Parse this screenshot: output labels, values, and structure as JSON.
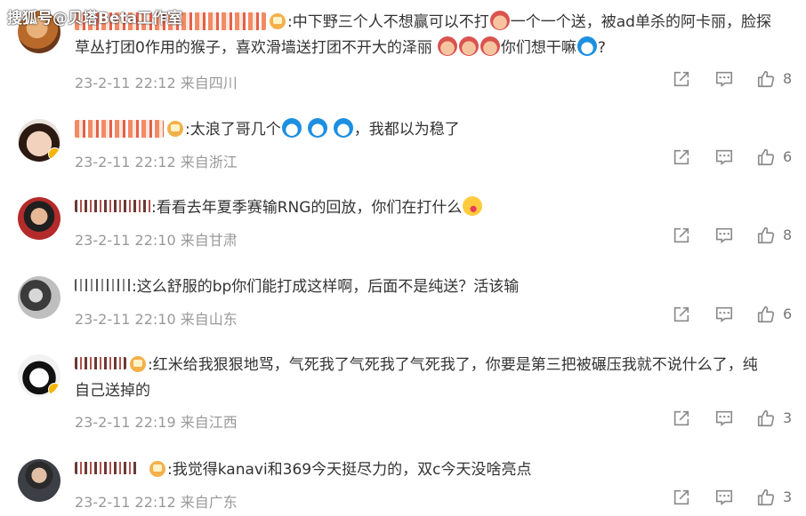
{
  "watermark": "搜狐号@贝塔Beta工作室",
  "comments": [
    {
      "text_parts": [
        ":中下野三个人不想赢可以不打",
        "一个一个送，被ad单杀的阿卡丽，脸探",
        "草丛打团0作用的猴子，喜欢滑墙送打团不开大的泽丽",
        "你们想干嘛",
        "?"
      ],
      "meta": "23-2-11 22:12 来自四川",
      "likes": "8"
    },
    {
      "text_parts": [
        ":太浪了哥几个",
        "，我都以为稳了"
      ],
      "meta": "23-2-11 22:12 来自浙江",
      "likes": "6"
    },
    {
      "text_parts": [
        ":看看去年夏季赛输RNG的回放，你们在打什么"
      ],
      "meta": "23-2-11 22:10 来自甘肃",
      "likes": "8"
    },
    {
      "text_parts": [
        ":这么舒服的bp你们能打成这样啊，后面不是纯送？活该输"
      ],
      "meta": "23-2-11 22:10 来自山东",
      "likes": "6"
    },
    {
      "text_parts": [
        ":红米给我狠狠地骂，气死我了气死我了气死我了，你要是第三把被碾压我就不说什么了，纯",
        "自己送掉的"
      ],
      "meta": "23-2-11 22:19 来自江西",
      "likes": "3"
    },
    {
      "text_parts": [
        ":我觉得kanavi和369今天挺尽力的，双c今天没啥亮点"
      ],
      "meta": "23-2-11 22:12 来自广东",
      "likes": "3"
    }
  ],
  "icons": {
    "share": "share-icon",
    "reply": "comment-icon",
    "like": "thumb-up-icon"
  },
  "colors": {
    "text": "#333333",
    "meta": "#999999",
    "icon": "#8a8a8a"
  }
}
